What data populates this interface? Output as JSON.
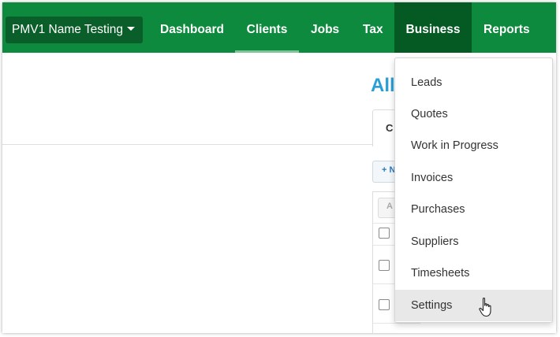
{
  "navbar": {
    "org_name": "PMV1 Name Testing",
    "items": [
      {
        "label": "Dashboard"
      },
      {
        "label": "Clients"
      },
      {
        "label": "Jobs"
      },
      {
        "label": "Tax"
      },
      {
        "label": "Business"
      },
      {
        "label": "Reports"
      }
    ],
    "active_item": "Clients",
    "open_item": "Business"
  },
  "page": {
    "heading": "All",
    "tab_label": "C",
    "add_button_label": "+ N",
    "filter_label": "A"
  },
  "business_menu": {
    "items": [
      {
        "label": "Leads"
      },
      {
        "label": "Quotes"
      },
      {
        "label": "Work in Progress"
      },
      {
        "label": "Invoices"
      },
      {
        "label": "Purchases"
      },
      {
        "label": "Suppliers"
      },
      {
        "label": "Timesheets"
      },
      {
        "label": "Settings"
      }
    ],
    "hovered_item": "Settings"
  },
  "colors": {
    "navbar_bg": "#0d8a3d",
    "org_button_bg": "#0a5e2a",
    "open_item_bg": "#055a23",
    "heading_color": "#2a9fd6"
  },
  "icons": {
    "cursor": "hand-pointer-icon",
    "org_caret": "caret-down-icon"
  }
}
